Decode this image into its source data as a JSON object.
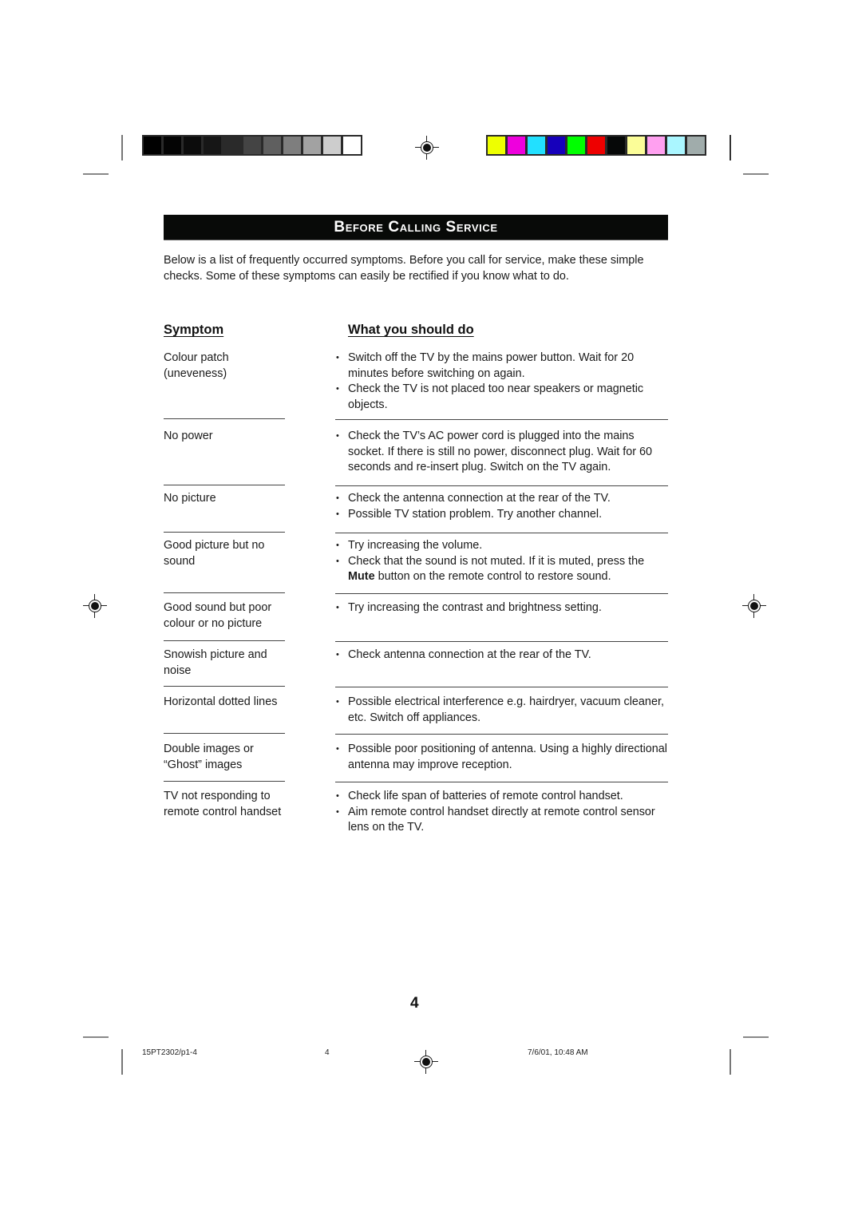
{
  "print_marks": {
    "grayscale_swatches": [
      "#000000",
      "#040404",
      "#0c0c0c",
      "#161616",
      "#2a2a2a",
      "#444444",
      "#5f5f5f",
      "#7e7e7e",
      "#a2a2a2",
      "#cdcdcd",
      "#ffffff"
    ],
    "color_swatches": [
      "#eeff00",
      "#ee00dd",
      "#22e0ff",
      "#1600bb",
      "#00ff00",
      "#ee0000",
      "#060808",
      "#fbfd98",
      "#ffa0f0",
      "#aaf6ff",
      "#a0acab"
    ],
    "registration_icon": "crosshair-target-icon"
  },
  "header": {
    "title": "Before Calling Service"
  },
  "intro": "Below is a list of frequently occurred symptoms. Before you call for service, make these simple checks. Some of these symptoms can easily be rectified if you know what to do.",
  "table": {
    "columns": [
      "Symptom",
      "What you should do"
    ],
    "rows": [
      {
        "symptom": "Colour patch (uneveness)",
        "actions": [
          "Switch off the TV by the mains power button. Wait for 20 minutes before switching on again.",
          "Check the TV is not placed too near speakers or magnetic objects."
        ]
      },
      {
        "symptom": "No power",
        "actions": [
          "Check the TV’s AC power cord is plugged into the mains socket. If there is still no power, disconnect plug. Wait for 60 seconds and re-insert plug. Switch on the TV again."
        ]
      },
      {
        "symptom": "No picture",
        "actions": [
          "Check the antenna connection at the rear of the TV.",
          "Possible TV station problem. Try another channel."
        ]
      },
      {
        "symptom": "Good picture but no sound",
        "actions": [
          "Try increasing the volume.",
          "Check that the sound is not muted. If it is muted, press the Mute button on the remote control to restore sound."
        ],
        "bold_term": "Mute"
      },
      {
        "symptom": "Good sound but poor colour or no picture",
        "actions": [
          "Try increasing the contrast and brightness setting."
        ]
      },
      {
        "symptom": "Snowish picture and noise",
        "actions": [
          "Check antenna connection at the rear of the TV."
        ]
      },
      {
        "symptom": "Horizontal dotted lines",
        "actions": [
          "Possible electrical interference e.g. hairdryer, vacuum cleaner, etc. Switch off appliances."
        ]
      },
      {
        "symptom": "Double images or “Ghost” images",
        "actions": [
          "Possible poor positioning of antenna. Using a highly directional antenna may improve reception."
        ]
      },
      {
        "symptom": "TV not responding to remote control handset",
        "actions": [
          "Check life span of batteries of remote control handset.",
          "Aim remote control handset directly at remote control sensor lens on the TV."
        ]
      }
    ]
  },
  "page_number": "4",
  "footer": {
    "file": "15PT2302/p1-4",
    "page": "4",
    "timestamp": "7/6/01, 10:48 AM"
  }
}
